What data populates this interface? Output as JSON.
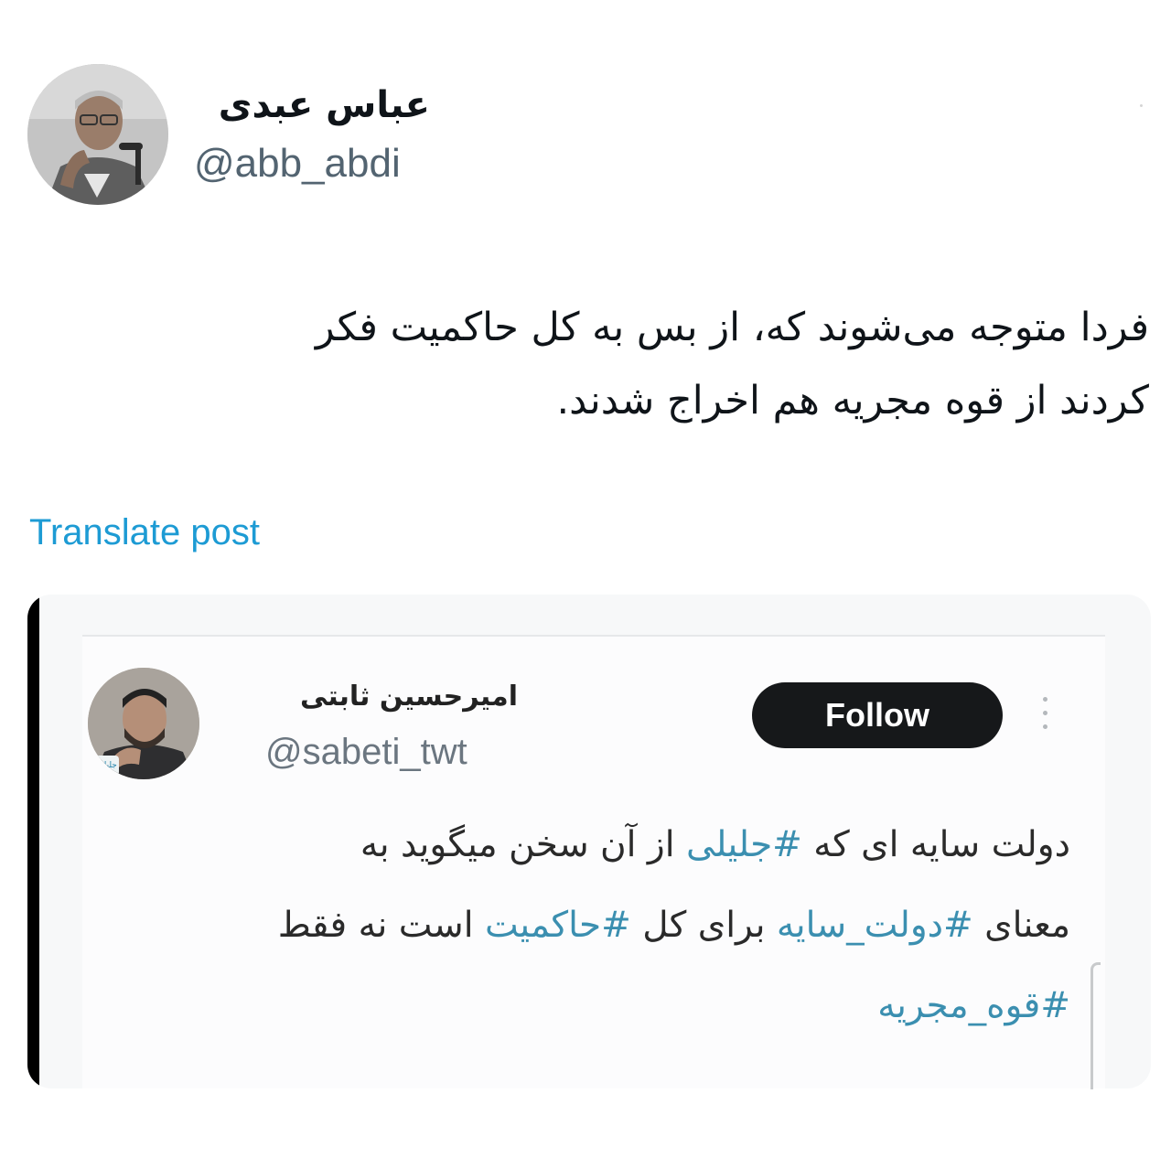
{
  "author": {
    "name": "عباس عبدی",
    "handle": "@abb_abdi"
  },
  "tweet": {
    "lines": [
      "فردا متوجه می‌شوند که، از بس به کل حاکمیت فکر",
      "کردند از قوه مجریه هم اخراج شدند."
    ],
    "translate_label": "Translate post"
  },
  "quoted": {
    "name": "امیرحسین ثابتی",
    "handle": "@sabeti_twt",
    "follow_label": "Follow",
    "line1": {
      "before": "دولت سایه ای که ",
      "hashtag": "#جلیلی",
      "after": " از آن سخن میگوید به"
    },
    "line2": {
      "before": "معنای ",
      "hashtag1": "#دولت_سایه",
      "middle": " برای کل ",
      "hashtag2": "#حاکمیت",
      "after": " است نه فقط"
    },
    "line3": {
      "hashtag": "#قوه_مجریه"
    },
    "avatar_caption": "جلیلی"
  },
  "colors": {
    "link": "#1d9bd4",
    "hashtag": "#3b8fb0",
    "text": "#0f1419",
    "handle": "#536471",
    "follow_bg": "#16181a"
  }
}
